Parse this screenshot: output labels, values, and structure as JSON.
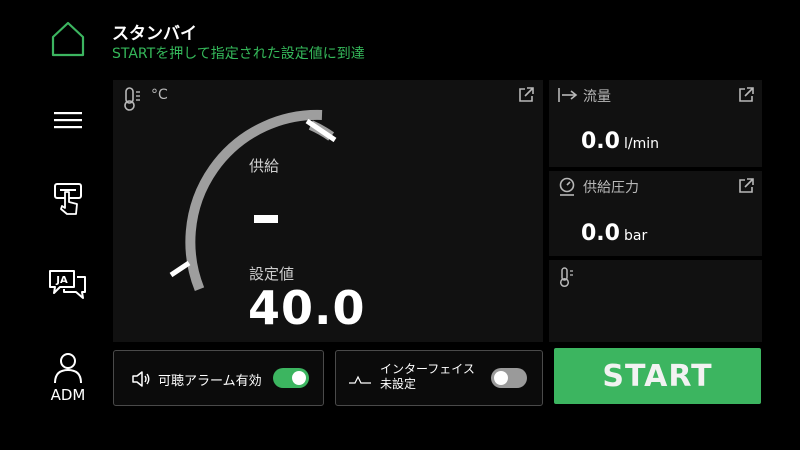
{
  "header": {
    "status": "スタンバイ",
    "message": "STARTを押して指定された設定値に到達"
  },
  "nav": {
    "user_label": "ADM",
    "language_badge": "JA"
  },
  "gauge": {
    "unit": "°C",
    "supply_label": "供給",
    "supply_value": "–",
    "setpoint_label": "設定値",
    "setpoint_value": "40.0"
  },
  "flow": {
    "label": "流量",
    "value": "0.0",
    "unit": "l/min"
  },
  "pressure": {
    "label": "供給圧力",
    "value": "0.0",
    "unit": "bar"
  },
  "controls": {
    "alarm_label": "可聴アラーム有効",
    "alarm_enabled": true,
    "interface_label_line1": "インターフェイス",
    "interface_label_line2": "未設定",
    "interface_enabled": false,
    "start_label": "START"
  },
  "colors": {
    "accent_green": "#3cb560",
    "status_green": "#35b85a",
    "toggle_off": "#9a9a9a",
    "gauge_arc": "#9e9e9e"
  }
}
